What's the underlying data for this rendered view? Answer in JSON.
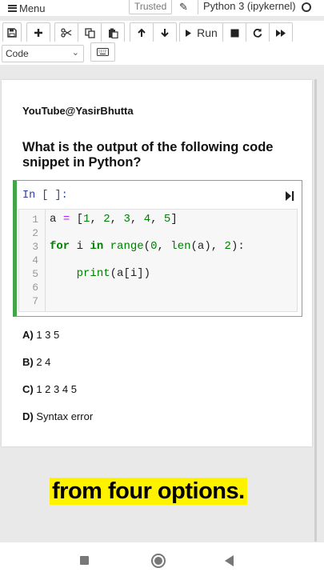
{
  "menubar": {
    "menu_label": "Menu",
    "trusted_label": "Trusted",
    "kernel_label": "Python 3 (ipykernel)"
  },
  "toolbar": {
    "run_label": "Run",
    "cell_type": "Code"
  },
  "notebook": {
    "channel": "YouTube@YasirBhutta",
    "question": "What is the output of the following code snippet in Python?",
    "cell_prompt": "In [ ]:",
    "line_numbers": [
      "1",
      "2",
      "3",
      "4",
      "5",
      "6",
      "7"
    ],
    "code_lines": [
      "a = [1, 2, 3, 4, 5]",
      "",
      "for i in range(0, len(a), 2):",
      "",
      "    print(a[i])",
      "",
      ""
    ],
    "options": [
      {
        "letter": "A)",
        "text": "1 3 5"
      },
      {
        "letter": "B)",
        "text": "2 4"
      },
      {
        "letter": "C)",
        "text": "1 2 3 4 5"
      },
      {
        "letter": "D)",
        "text": "Syntax error"
      }
    ]
  },
  "caption": "from four options.",
  "colors": {
    "cell_border": "#42a547",
    "prompt": "#303f9f",
    "caption_bg": "#fff200"
  },
  "icons": [
    "hamburger-icon",
    "pencil-icon",
    "kernel-indicator-icon",
    "save-icon",
    "plus-icon",
    "scissors-icon",
    "copy-icon",
    "paste-icon",
    "arrow-up-icon",
    "arrow-down-icon",
    "play-icon",
    "stop-icon",
    "restart-icon",
    "fast-forward-icon",
    "keyboard-icon",
    "run-cell-icon"
  ]
}
